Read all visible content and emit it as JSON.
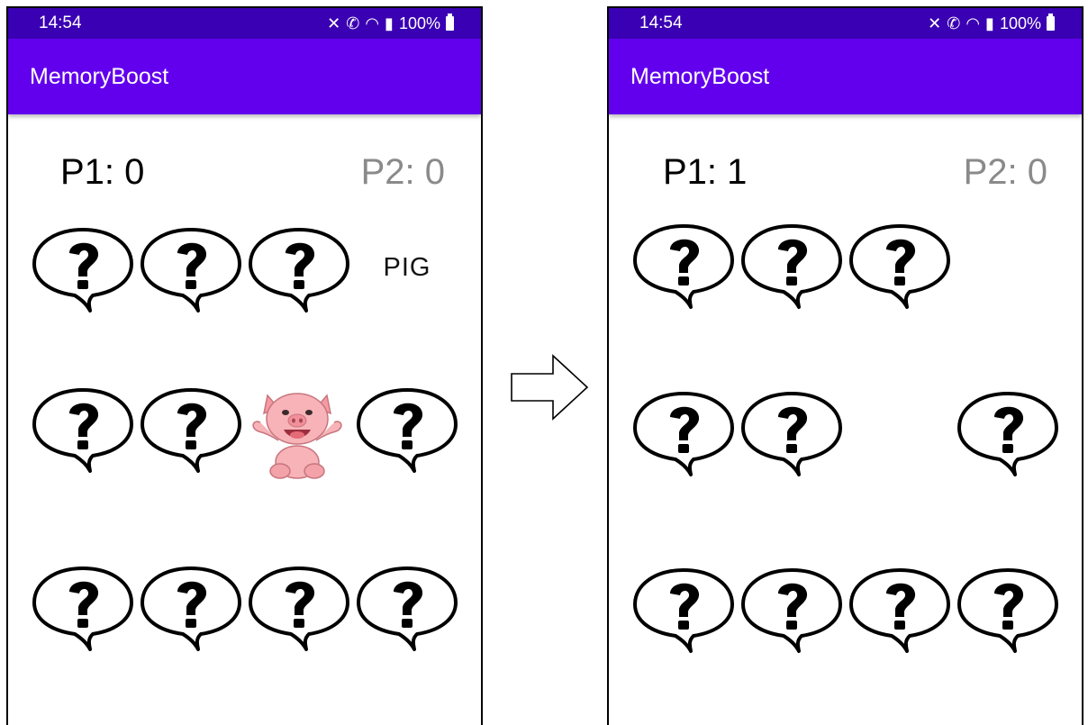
{
  "colors": {
    "status_bar": "#3a00b3",
    "app_bar": "#6200ee",
    "p1_text": "#000000",
    "p2_text": "#8a8a8a"
  },
  "left_screen": {
    "status": {
      "time": "14:54",
      "battery": "100%",
      "icons": [
        "mute-icon",
        "call-icon",
        "wifi-icon",
        "signal-icon",
        "battery-icon"
      ]
    },
    "app_title": "MemoryBoost",
    "scores": {
      "p1": "P1: 0",
      "p2": "P2: 0"
    },
    "grid": [
      [
        "question",
        "question",
        "question",
        "word:PIG"
      ],
      [
        "question",
        "question",
        "pig",
        "question"
      ],
      [
        "question",
        "question",
        "question",
        "question"
      ]
    ],
    "word_card": "PIG"
  },
  "right_screen": {
    "status": {
      "time": "14:54",
      "battery": "100%",
      "icons": [
        "mute-icon",
        "call-icon",
        "wifi-icon",
        "signal-icon",
        "battery-icon"
      ]
    },
    "app_title": "MemoryBoost",
    "scores": {
      "p1": "P1: 1",
      "p2": "P2: 0"
    },
    "grid": [
      [
        "question",
        "question",
        "question",
        "empty"
      ],
      [
        "question",
        "question",
        "empty",
        "question"
      ],
      [
        "question",
        "question",
        "question",
        "question"
      ]
    ]
  },
  "transition_icon": "arrow-right-icon"
}
